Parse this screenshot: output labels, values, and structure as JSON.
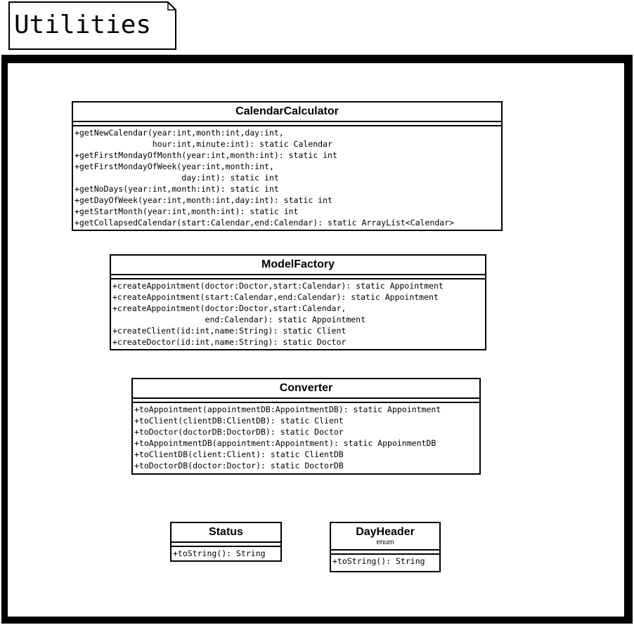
{
  "package": {
    "name": "Utilities"
  },
  "classes": {
    "calendar_calculator": {
      "name": "CalendarCalculator",
      "operations": [
        "+getNewCalendar(year:int,month:int,day:int,",
        "                hour:int,minute:int): static Calendar",
        "+getFirstMondayOfMonth(year:int,month:int): static int",
        "+getFirstMondayOfWeek(year:int,month:int,",
        "                      day:int): static int",
        "+getNoDays(year:int,month:int): static int",
        "+getDayOfWeek(year:int,month:int,day:int): static int",
        "+getStartMonth(year:int,month:int): static int",
        "+getCollapsedCalendar(start:Calendar,end:Calendar): static ArrayList<Calendar>"
      ]
    },
    "model_factory": {
      "name": "ModelFactory",
      "operations": [
        "+createAppointment(doctor:Doctor,start:Calendar): static Appointment",
        "+createAppointment(start:Calendar,end:Calendar): static Appointment",
        "+createAppointment(doctor:Doctor,start:Calendar,",
        "                   end:Calendar): static Appointment",
        "+createClient(id:int,name:String): static Client",
        "+createDoctor(id:int,name:String): static Doctor"
      ]
    },
    "converter": {
      "name": "Converter",
      "operations": [
        "+toAppointment(appointmentDB:AppointmentDB): static Appointment",
        "+toClient(clientDB:ClientDB): static Client",
        "+toDoctor(doctorDB:DoctorDB): static Doctor",
        "+toAppointmentDB(appointment:Appointment): static AppoinmentDB",
        "+toClientDB(client:Client): static ClientDB",
        "+toDoctorDB(doctor:Doctor): static DoctorDB"
      ]
    },
    "status": {
      "name": "Status",
      "operations": [
        "+toString(): String"
      ]
    },
    "day_header": {
      "name": "DayHeader",
      "stereotype": "enum",
      "operations": [
        "+toString(): String"
      ]
    }
  }
}
